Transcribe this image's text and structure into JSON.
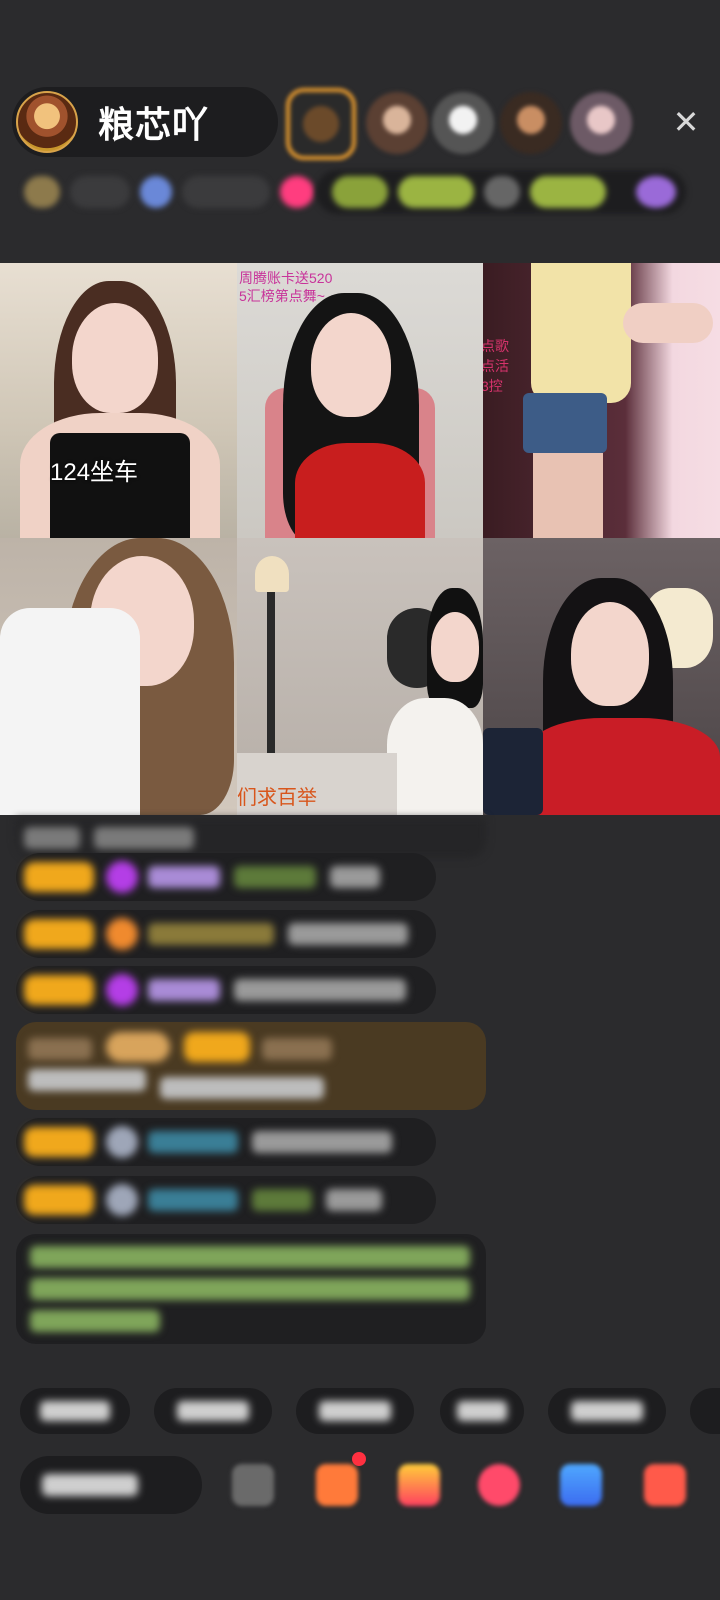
{
  "header": {
    "host_name": "粮芯吖",
    "close_icon": "close-icon"
  },
  "video_grid": {
    "tiles": [
      {
        "caption": "124坐车"
      },
      {
        "caption_line1": "周腾账卡送520",
        "caption_line2": "5汇榜第点舞~"
      },
      {
        "caption_line1": "点歌",
        "caption_line2": "点活",
        "caption_line3": "3控"
      },
      {
        "caption": ""
      },
      {
        "caption": "们求百举"
      },
      {
        "caption": ""
      }
    ]
  },
  "colors": {
    "background": "#2b2b2d",
    "pill": "#1d1d1f",
    "badge": "#f0a81c",
    "accent_pink": "#ff3d7f",
    "chat_green": "#8ec36a",
    "chat_cyan": "#4fc3d8",
    "chat_purple": "#b58cff"
  }
}
